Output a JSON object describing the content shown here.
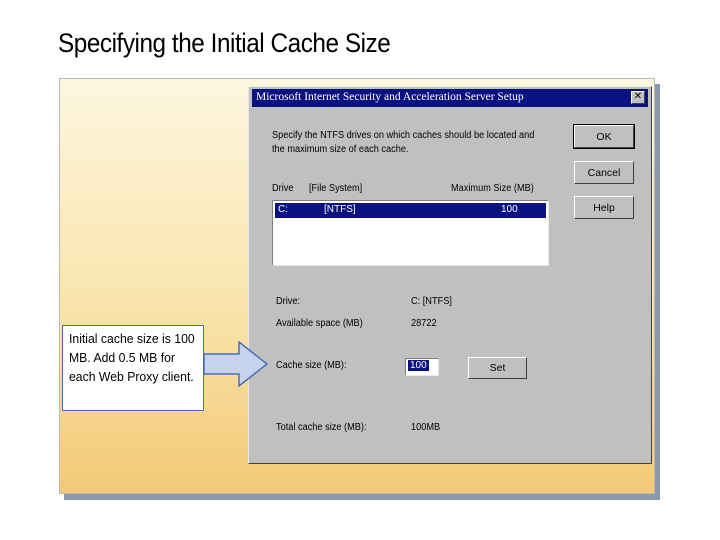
{
  "slide": {
    "title": "Specifying the Initial Cache Size"
  },
  "dialog": {
    "title": "Microsoft Internet Security and Acceleration Server Setup",
    "close_glyph": "✕",
    "instruction": "Specify the NTFS drives on which caches should be located and the maximum size of each cache.",
    "buttons": {
      "ok": "OK",
      "cancel": "Cancel",
      "help": "Help",
      "set": "Set"
    },
    "list": {
      "headers": [
        "Drive",
        "[File System]",
        "Maximum Size (MB)"
      ],
      "rows": [
        {
          "drive": "C:",
          "fs": "[NTFS]",
          "size": "100"
        }
      ]
    },
    "fields": {
      "drive_label": "Drive:",
      "drive_value": "C: [NTFS]",
      "available_label": "Available space (MB)",
      "available_value": "28722",
      "cache_label": "Cache size (MB):",
      "cache_value": "100",
      "total_label": "Total cache size (MB):",
      "total_value": "100MB"
    }
  },
  "callout": {
    "text": "Initial cache size is 100 MB. Add 0.5 MB for each Web Proxy client."
  },
  "colors": {
    "titlebar": "#0a1282",
    "dialog_face": "#c0c0c0",
    "panel_top": "#fdf6df",
    "panel_bottom": "#f3c977",
    "arrow_fill": "#c7d2ee",
    "arrow_stroke": "#4a6fb0"
  },
  "icons": {
    "close": "close-icon",
    "arrow": "right-arrow-icon"
  }
}
